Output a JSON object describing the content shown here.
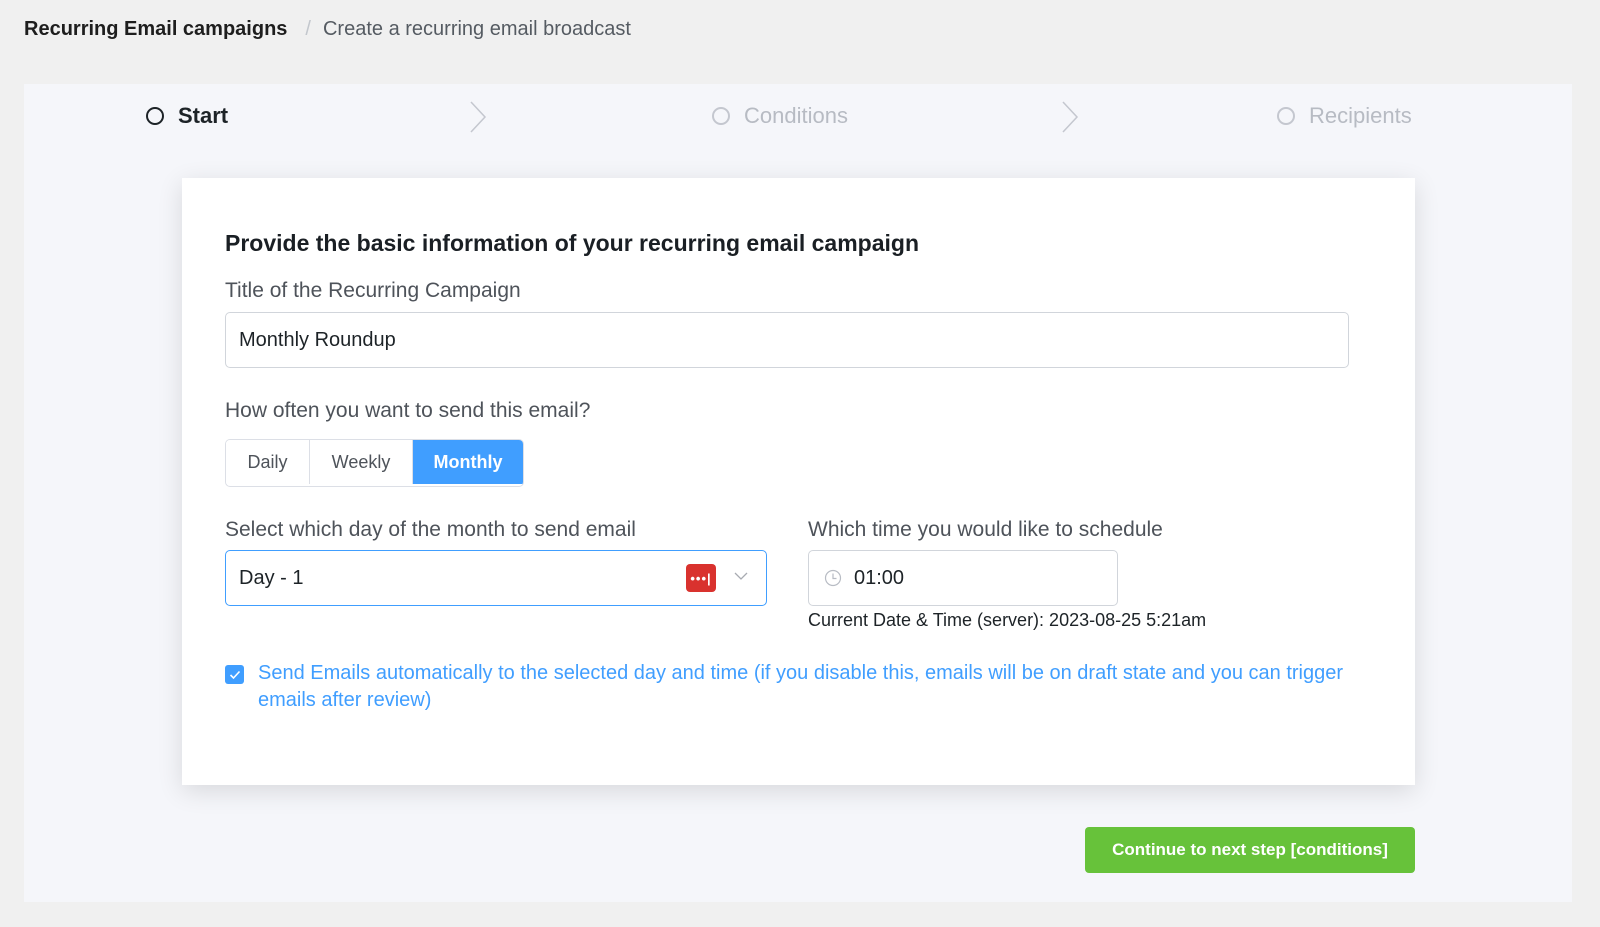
{
  "breadcrumb": {
    "root": "Recurring Email campaigns",
    "separator": "/",
    "current": "Create a recurring email broadcast"
  },
  "steps": [
    {
      "label": "Start",
      "state": "active"
    },
    {
      "label": "Conditions",
      "state": "inactive"
    },
    {
      "label": "Recipients",
      "state": "inactive"
    }
  ],
  "form": {
    "heading": "Provide the basic information of your recurring email campaign",
    "title_label": "Title of the Recurring Campaign",
    "title_value": "Monthly Roundup",
    "frequency_label": "How often you want to send this email?",
    "frequency_options": [
      {
        "label": "Daily",
        "selected": false
      },
      {
        "label": "Weekly",
        "selected": false
      },
      {
        "label": "Monthly",
        "selected": true
      }
    ],
    "day_label": "Select which day of the month to send email",
    "day_value": "Day - 1",
    "time_label": "Which time you would like to schedule",
    "time_value": "01:00",
    "server_time": "Current Date & Time (server): 2023-08-25 5:21am",
    "auto_send_checked": true,
    "auto_send_label": "Send Emails automatically to the selected day and time (if you disable this, emails will be on draft state and you can trigger emails after review)"
  },
  "actions": {
    "continue_label": "Continue to next step [conditions]"
  },
  "colors": {
    "primary": "#409eff",
    "success": "#67c23a",
    "password_manager": "#d9322e"
  }
}
